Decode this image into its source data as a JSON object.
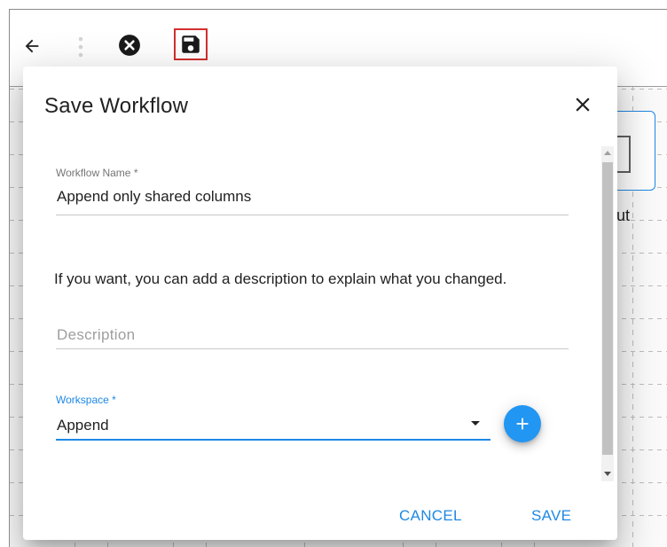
{
  "toolbar": {
    "back_icon": "arrow-back-icon",
    "more_icon": "more-vertical-icon",
    "close_icon": "close-circle-icon",
    "save_icon": "floppy-save-icon",
    "save_highlight_color": "#d32f2f"
  },
  "canvas": {
    "node_label": "ut",
    "node_border_color": "#1e88e5"
  },
  "dialog": {
    "title": "Save Workflow",
    "close_icon": "close-icon",
    "workflow_name": {
      "label": "Workflow Name",
      "required_mark": "*",
      "value": "Append only shared columns"
    },
    "help_text": "If you want, you can add a description to explain what you changed.",
    "description": {
      "placeholder": "Description",
      "value": ""
    },
    "workspace": {
      "label": "Workspace",
      "required_mark": "*",
      "selected": "Append"
    },
    "add_workspace_icon": "plus-icon",
    "actions": {
      "cancel": "CANCEL",
      "save": "SAVE"
    },
    "accent_color": "#1e88e5"
  }
}
